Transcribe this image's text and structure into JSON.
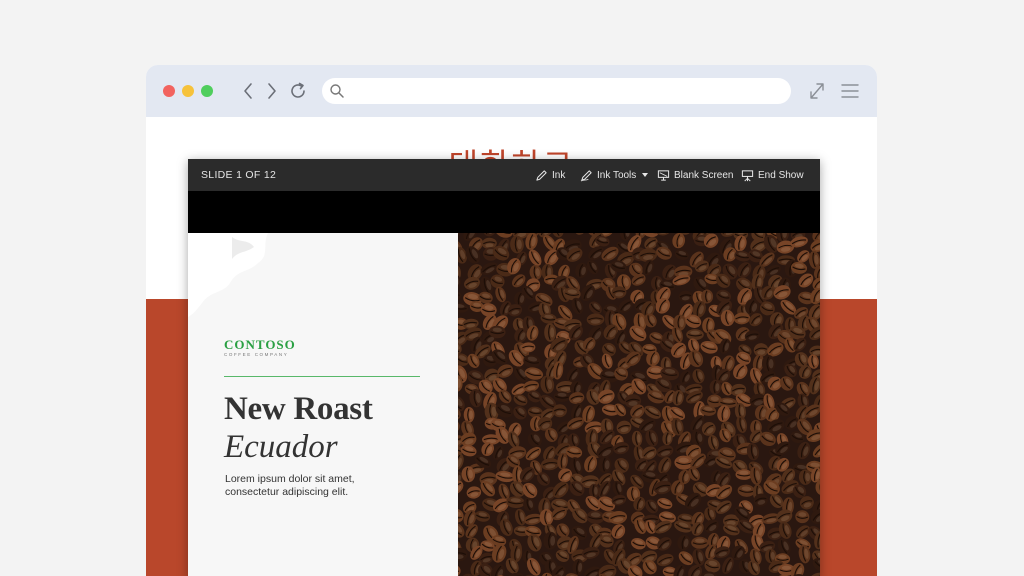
{
  "browser": {
    "url_value": "",
    "heading_peek": "대화하고"
  },
  "presentation": {
    "slide_counter": "SLIDE 1 OF 12",
    "toolbar": {
      "ink": "Ink",
      "ink_tools": "Ink Tools",
      "blank_screen": "Blank Screen",
      "end_show": "End Show"
    },
    "slide": {
      "brand": "CONTOSO",
      "brand_sub": "COFFEE COMPANY",
      "title_line1": "New Roast",
      "title_line2": "Ecuador",
      "body_line1": "Lorem ipsum dolor sit amet,",
      "body_line2": "consectetur adipiscing elit."
    }
  },
  "colors": {
    "accent_red": "#b9472b",
    "brand_green": "#2aa043",
    "toolbar_bg": "#2b2b2b",
    "chrome_bg": "#e3e8f2"
  },
  "icons": {
    "back": "chevron-left-icon",
    "forward": "chevron-right-icon",
    "reload": "reload-icon",
    "search": "search-icon",
    "expand": "expand-icon",
    "menu": "hamburger-menu-icon",
    "ink": "pen-icon",
    "ink_tools": "pen-tools-icon",
    "blank_screen": "screen-icon",
    "end_show": "projector-icon"
  }
}
